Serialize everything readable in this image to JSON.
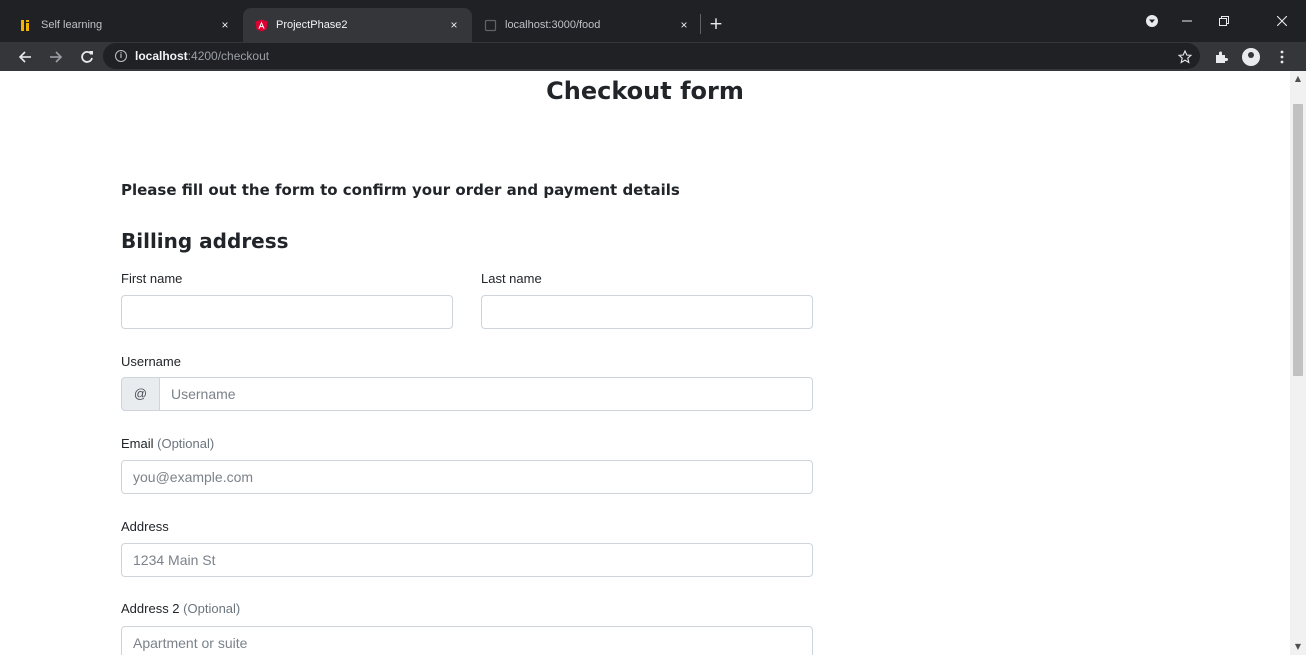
{
  "browser": {
    "tabs": [
      {
        "title": "Self learning",
        "favicon": "self-learning-favicon",
        "active": false
      },
      {
        "title": "ProjectPhase2",
        "favicon": "angular-favicon",
        "active": true
      },
      {
        "title": "localhost:3000/food",
        "favicon": "blank-page-favicon",
        "active": false
      }
    ],
    "close_glyph": "×",
    "new_tab_glyph": "+",
    "address": {
      "host": "localhost",
      "path": ":4200/checkout"
    },
    "icons": {
      "back": "back-arrow-icon",
      "forward": "forward-arrow-icon",
      "reload": "reload-icon",
      "info": "site-info-icon",
      "star": "bookmark-star-icon",
      "extensions": "puzzle-piece-icon",
      "profile": "profile-avatar-icon",
      "menu": "kebab-menu-icon"
    },
    "colors": {
      "tabbar": "#202124",
      "toolbar": "#35363a",
      "omnibox": "#202124"
    }
  },
  "page": {
    "title": "Checkout form",
    "lead": "Please fill out the form to confirm your order and payment details",
    "billing": {
      "heading": "Billing address",
      "first_name": {
        "label": "First name",
        "value": "",
        "placeholder": ""
      },
      "last_name": {
        "label": "Last name",
        "value": "",
        "placeholder": ""
      },
      "username": {
        "label": "Username",
        "prefix": "@",
        "value": "",
        "placeholder": "Username"
      },
      "email": {
        "label": "Email",
        "optional": "(Optional)",
        "value": "",
        "placeholder": "you@example.com"
      },
      "address": {
        "label": "Address",
        "value": "",
        "placeholder": "1234 Main St"
      },
      "address2": {
        "label": "Address 2",
        "optional": "(Optional)",
        "value": "",
        "placeholder": "Apartment or suite"
      }
    },
    "colors": {
      "text": "#212529",
      "muted": "#6c757d",
      "border": "#ced4da",
      "addon": "#e9ecef"
    }
  }
}
